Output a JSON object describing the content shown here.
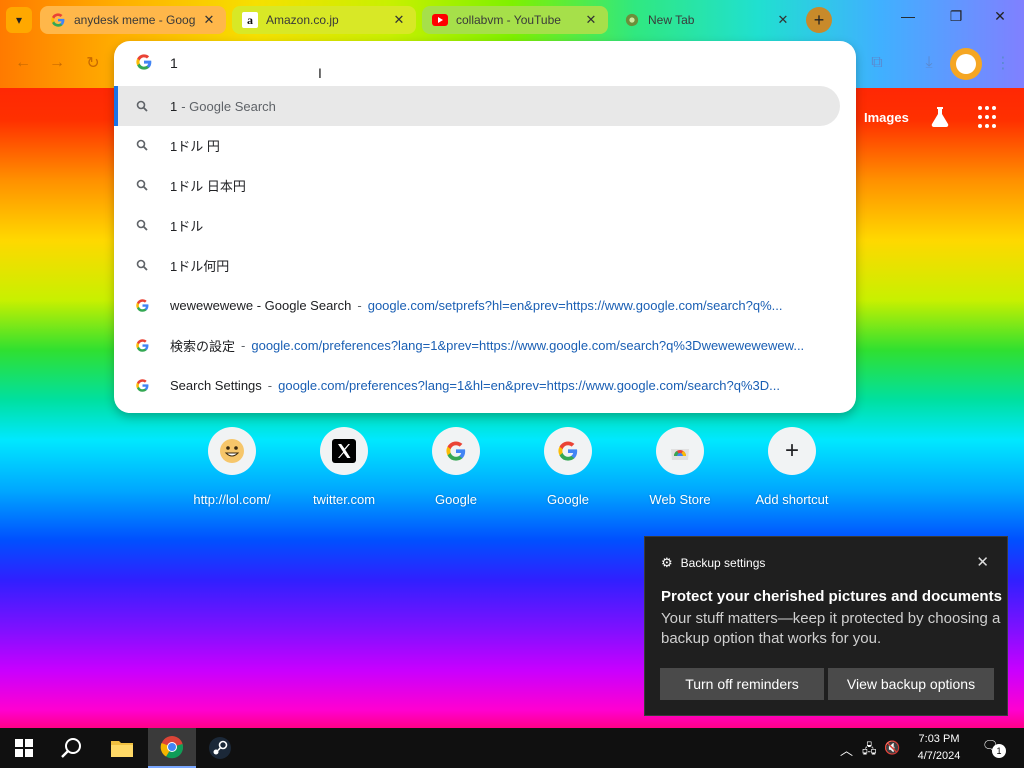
{
  "browser": {
    "tabs": [
      {
        "title": "anydesk meme - Goog",
        "favicon": "google-g-icon"
      },
      {
        "title": "Amazon.co.jp",
        "favicon": "amazon-icon"
      },
      {
        "title": "collabvm - YouTube",
        "favicon": "youtube-icon"
      },
      {
        "title": "New Tab",
        "favicon": "chrome-icon"
      }
    ],
    "tab_close_glyph": "✕"
  },
  "google_header": {
    "images_label": "Images"
  },
  "omnibox": {
    "input_value": "1",
    "suggestions": [
      {
        "text": "1",
        "suffix": " - Google Search",
        "icon": "search-icon",
        "selected": true
      },
      {
        "text": "1ドル 円",
        "icon": "search-icon"
      },
      {
        "text": "1ドル 日本円",
        "icon": "search-icon"
      },
      {
        "text": "1ドル",
        "icon": "search-icon"
      },
      {
        "text": "1ドル何円",
        "icon": "search-icon"
      },
      {
        "text": "wewewewewe - Google Search",
        "url": "google.com/setprefs?hl=en&prev=https://www.google.com/search?q%...",
        "icon": "google-g-icon"
      },
      {
        "text": "検索の設定",
        "url": "google.com/preferences?lang=1&prev=https://www.google.com/search?q%3Dwewewewewew...",
        "icon": "google-g-icon"
      },
      {
        "text": "Search Settings",
        "url": "google.com/preferences?lang=1&hl=en&prev=https://www.google.com/search?q%3D...",
        "icon": "google-g-icon"
      }
    ]
  },
  "shortcuts": [
    {
      "label": "http://lol.com/",
      "icon": "smiley-icon"
    },
    {
      "label": "twitter.com",
      "icon": "x-logo-icon"
    },
    {
      "label": "Google",
      "icon": "google-g-icon"
    },
    {
      "label": "Google",
      "icon": "google-g-icon"
    },
    {
      "label": "Web Store",
      "icon": "webstore-icon"
    },
    {
      "label": "Add shortcut",
      "icon": "plus-icon"
    }
  ],
  "notification": {
    "app_name": "Backup settings",
    "title": "Protect your cherished pictures and documents",
    "body": "Your stuff matters—keep it protected by choosing a backup option that works for you.",
    "button_1": "Turn off reminders",
    "button_2": "View backup options"
  },
  "taskbar": {
    "time": "7:03 PM",
    "date": "4/7/2024",
    "notification_count": "1"
  },
  "colors": {
    "omnibox_selected_bar": "#1a73e8",
    "url_color": "#1a5fb4",
    "notification_bg": "#1f1f1f",
    "taskbar_bg": "#101010"
  }
}
